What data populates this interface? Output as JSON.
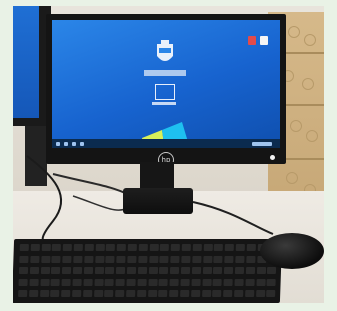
{
  "scene": {
    "subject": "desktop-computer-photo",
    "monitor_brand_mark": "hp",
    "colors": {
      "frame_border": "#e9f2e6",
      "screen_blue": "#1763cf",
      "desk": "#e9e4dc",
      "hardware_black": "#141414"
    },
    "icons": [
      "crest-icon",
      "login-icon",
      "hp-logo-icon",
      "power-led-icon"
    ]
  }
}
